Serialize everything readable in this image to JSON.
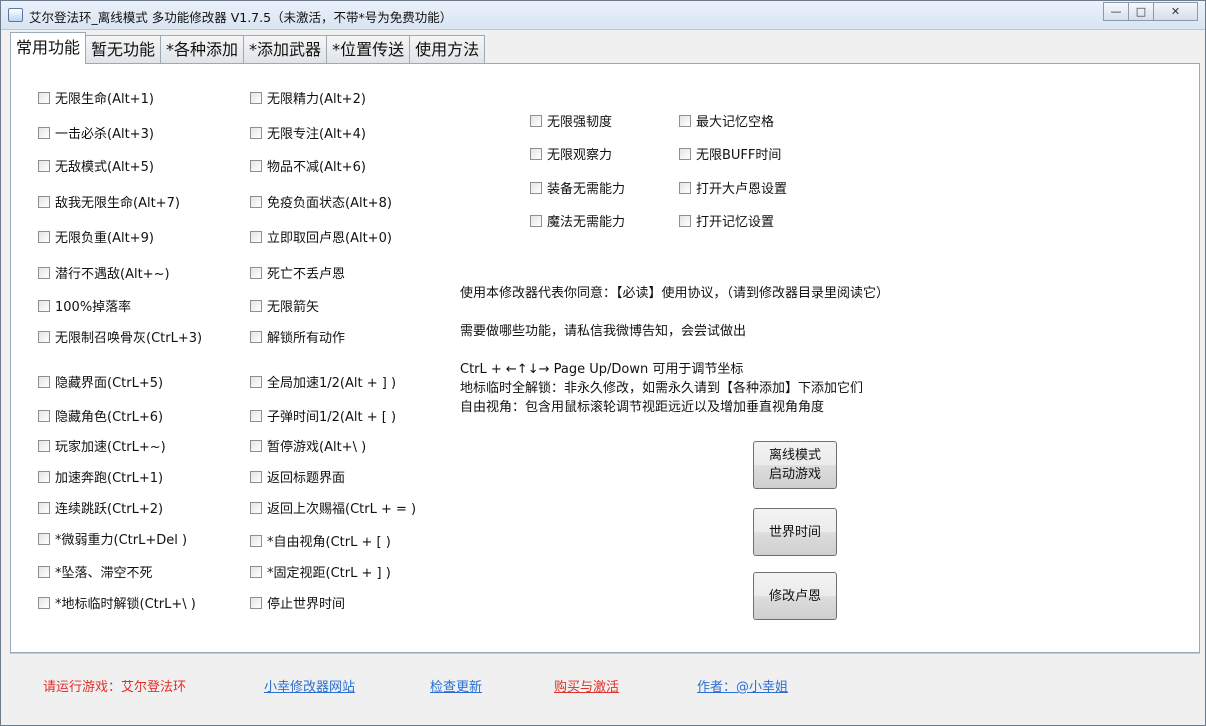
{
  "window": {
    "title": "艾尔登法环_离线模式 多功能修改器  V1.7.5（未激活，不带*号为免费功能）",
    "controls": {
      "minimize": "—",
      "maximize": "□",
      "close": "✕"
    }
  },
  "tabs": [
    "常用功能",
    "暂无功能",
    "*各种添加",
    "*添加武器",
    "*位置传送",
    "使用方法"
  ],
  "col1": [
    "无限生命(Alt+1)",
    "一击必杀(Alt+3)",
    "无敌模式(Alt+5)",
    "敌我无限生命(Alt+7)",
    "无限负重(Alt+9)",
    "潜行不遇敌(Alt+~)",
    "100%掉落率",
    "无限制召唤骨灰(CtrL+3)",
    "隐藏界面(CtrL+5)",
    "隐藏角色(CtrL+6)",
    "玩家加速(CtrL+~)",
    "加速奔跑(CtrL+1)",
    "连续跳跃(CtrL+2)",
    "*微弱重力(CtrL+Del )",
    "*坠落、滞空不死",
    "*地标临时解锁(CtrL+\\ )"
  ],
  "col2": [
    "无限精力(Alt+2)",
    "无限专注(Alt+4)",
    "物品不减(Alt+6)",
    "免疫负面状态(Alt+8)",
    "立即取回卢恩(Alt+0)",
    "死亡不丢卢恩",
    "无限箭矢",
    "解锁所有动作",
    "全局加速1/2(Alt + ] )",
    "子弹时间1/2(Alt + [ )",
    "暂停游戏(Alt+\\ )",
    "返回标题界面",
    "返回上次赐福(CtrL + = )",
    "*自由视角(CtrL + [ )",
    "*固定视距(CtrL + ] )",
    "停止世界时间"
  ],
  "col3": [
    "无限强韧度",
    "无限观察力",
    "装备无需能力",
    "魔法无需能力"
  ],
  "col4": [
    "最大记忆空格",
    "无限BUFF时间",
    "打开大卢恩设置",
    "打开记忆设置"
  ],
  "info": [
    "使用本修改器代表你同意：【必读】使用协议，（请到修改器目录里阅读它）",
    "需要做哪些功能，请私信我微博告知，会尝试做出",
    "CtrL + ←↑↓→ Page Up/Down 可用于调节坐标",
    "地标临时全解锁：非永久修改，如需永久请到【各种添加】下添加它们",
    "自由视角：包含用鼠标滚轮调节视距远近以及增加垂直视角角度"
  ],
  "buttons": {
    "offline": "离线模式\n启动游戏",
    "world_time": "世界时间",
    "runes": "修改卢恩"
  },
  "footer": {
    "status": "请运行游戏：艾尔登法环",
    "website": "小幸修改器网站",
    "update": "检查更新",
    "buy": "购买与激活",
    "author": "作者：@小幸姐"
  },
  "colors": {
    "status_red": "#e0302a",
    "link_blue": "#2a6fd1"
  }
}
